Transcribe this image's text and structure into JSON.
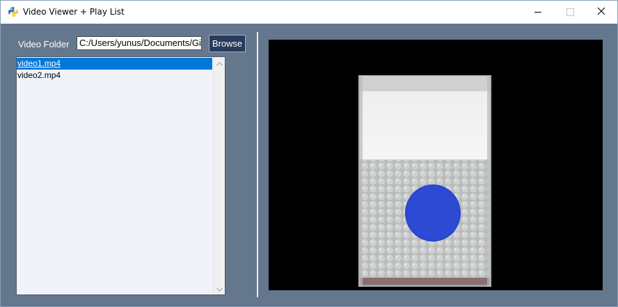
{
  "window": {
    "title": "Video Viewer + Play List",
    "app_icon": "python-icon"
  },
  "title_bar_buttons": {
    "minimize_icon": "minimize-icon",
    "maximize_icon": "maximize-icon",
    "close_icon": "close-icon",
    "close_glyph": "✕"
  },
  "folder": {
    "label": "Video Folder",
    "value": "C:/Users/yunus/Documents/Gi",
    "browse_label": "Browse"
  },
  "playlist": {
    "items": [
      "video1.mp4",
      "video2.mp4"
    ],
    "selected_index": 0
  },
  "scrollbar": {
    "up_icon": "chevron-up-icon",
    "down_icon": "chevron-down-icon"
  },
  "video": {
    "background": "#000000",
    "frame_description_icon": "video-frame-image"
  },
  "colors": {
    "window_bg": "#64778d",
    "button_bg": "#283b5b",
    "selection": "#0078d7",
    "list_bg": "#f0f4fa"
  }
}
